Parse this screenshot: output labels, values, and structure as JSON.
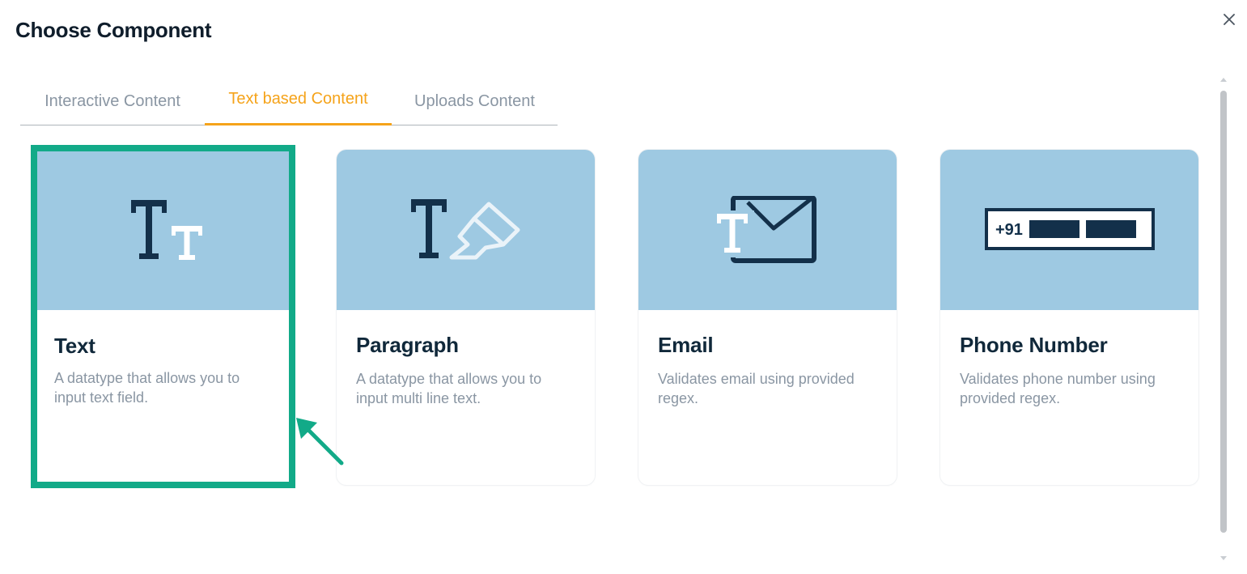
{
  "modal": {
    "title": "Choose Component",
    "close_label": "×"
  },
  "tabs": [
    {
      "label": "Interactive Content",
      "active": false
    },
    {
      "label": "Text based Content",
      "active": true
    },
    {
      "label": "Uploads Content",
      "active": false
    }
  ],
  "cards": [
    {
      "title": "Text",
      "description": "A datatype that allows you to input text field.",
      "icon": "text-size-icon",
      "selected": true
    },
    {
      "title": "Paragraph",
      "description": "A datatype that allows you to input multi line text.",
      "icon": "text-highlighter-icon",
      "selected": false
    },
    {
      "title": "Email",
      "description": "Validates email using provided regex.",
      "icon": "text-envelope-icon",
      "selected": false
    },
    {
      "title": "Phone Number",
      "description": "Validates phone number using provided regex.",
      "icon": "phone-field-icon",
      "selected": false,
      "icon_text": "+91"
    }
  ],
  "colors": {
    "accent_tab": "#f5a31a",
    "card_media_bg": "#9ec9e2",
    "icon_dark": "#13304a",
    "highlight": "#12aa88"
  }
}
